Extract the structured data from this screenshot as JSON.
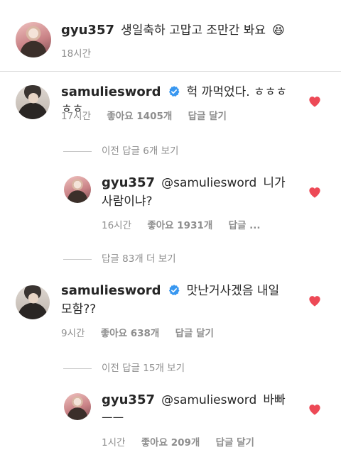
{
  "caption": {
    "username": "gyu357",
    "text": "생일축하 고맙고 조만간 봐요",
    "emoji": "😆",
    "time": "18시간"
  },
  "comments": [
    {
      "username": "samuliesword",
      "verified": true,
      "text": "헉 까먹었다. ㅎㅎㅎㅎㅎ",
      "time": "17시간",
      "likes": "좋아요 1405개",
      "reply_label": "답글 달기",
      "liked": true,
      "view_replies": "이전 답글 6개 보기",
      "reply": {
        "username": "gyu357",
        "mention": "@samuliesword",
        "text_line1": "니가",
        "text_line2": "사람이냐?",
        "time": "16시간",
        "likes": "좋아요 1931개",
        "reply_label": "답글 ...",
        "liked": true
      },
      "more_replies": "답글 83개 더 보기"
    },
    {
      "username": "samuliesword",
      "verified": true,
      "text_line1": "맛난거사겠음 내일",
      "text_line2": "모함??",
      "time": "9시간",
      "likes": "좋아요 638개",
      "reply_label": "답글 달기",
      "liked": true,
      "view_replies": "이전 답글 15개 보기",
      "reply": {
        "username": "gyu357",
        "mention": "@samuliesword",
        "text_line1": "바빠",
        "text_line2": "ㅡㅡ",
        "time": "1시간",
        "likes": "좋아요 209개",
        "reply_label": "답글 달기",
        "liked": true
      }
    }
  ],
  "colors": {
    "heart": "#ed4956",
    "verified": "#3897f0",
    "mention": "#00376b",
    "meta": "#8e8e8e"
  }
}
